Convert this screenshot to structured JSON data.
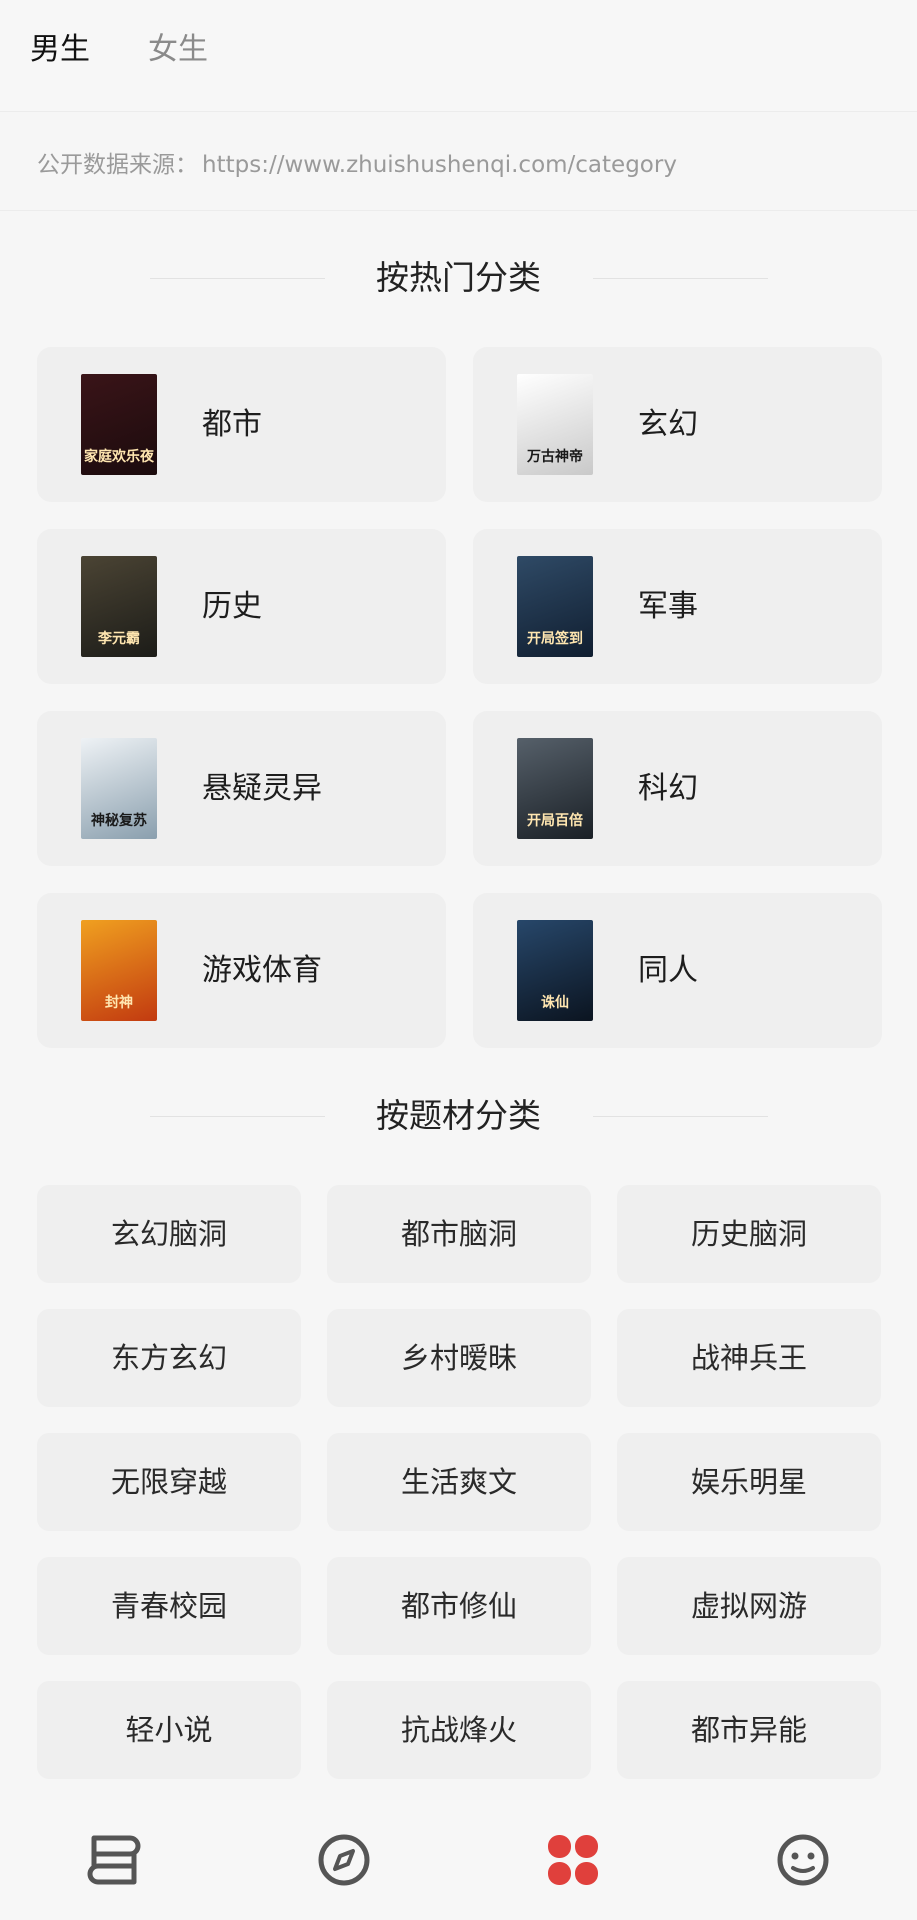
{
  "top_tabs": {
    "male": "男生",
    "female": "女生"
  },
  "source": {
    "label": "公开数据来源：",
    "url": "https://www.zhuishushenqi.com/category"
  },
  "hot_section": {
    "title": "按热门分类"
  },
  "hot_categories": [
    {
      "label": "都市",
      "cover_text": "家庭欢乐夜",
      "cover_colors": [
        "#3a1418",
        "#1b0b0d"
      ]
    },
    {
      "label": "玄幻",
      "cover_text": "万古神帝",
      "cover_colors": [
        "#ffffff",
        "#c9c9c9"
      ]
    },
    {
      "label": "历史",
      "cover_text": "李元霸",
      "cover_colors": [
        "#4b4434",
        "#1c1c18"
      ]
    },
    {
      "label": "军事",
      "cover_text": "开局签到",
      "cover_colors": [
        "#2f4a66",
        "#101e30"
      ]
    },
    {
      "label": "悬疑灵异",
      "cover_text": "神秘复苏",
      "cover_colors": [
        "#eef2f5",
        "#8a9fae"
      ]
    },
    {
      "label": "科幻",
      "cover_text": "开局百倍",
      "cover_colors": [
        "#56606a",
        "#1a2026"
      ]
    },
    {
      "label": "游戏体育",
      "cover_text": "封神",
      "cover_colors": [
        "#f0a020",
        "#c23a10"
      ]
    },
    {
      "label": "同人",
      "cover_text": "诛仙",
      "cover_colors": [
        "#27476a",
        "#0b1420"
      ]
    }
  ],
  "topic_section": {
    "title": "按题材分类"
  },
  "topic_categories": [
    "玄幻脑洞",
    "都市脑洞",
    "历史脑洞",
    "东方玄幻",
    "乡村暧昧",
    "战神兵王",
    "无限穿越",
    "生活爽文",
    "娱乐明星",
    "青春校园",
    "都市修仙",
    "虚拟网游",
    "轻小说",
    "抗战烽火",
    "都市异能"
  ],
  "bottom_nav": {
    "items": [
      "bookshelf-icon",
      "compass-icon",
      "category-grid-icon",
      "profile-face-icon"
    ],
    "active_color": "#e0403c",
    "inactive_color": "#555555"
  }
}
